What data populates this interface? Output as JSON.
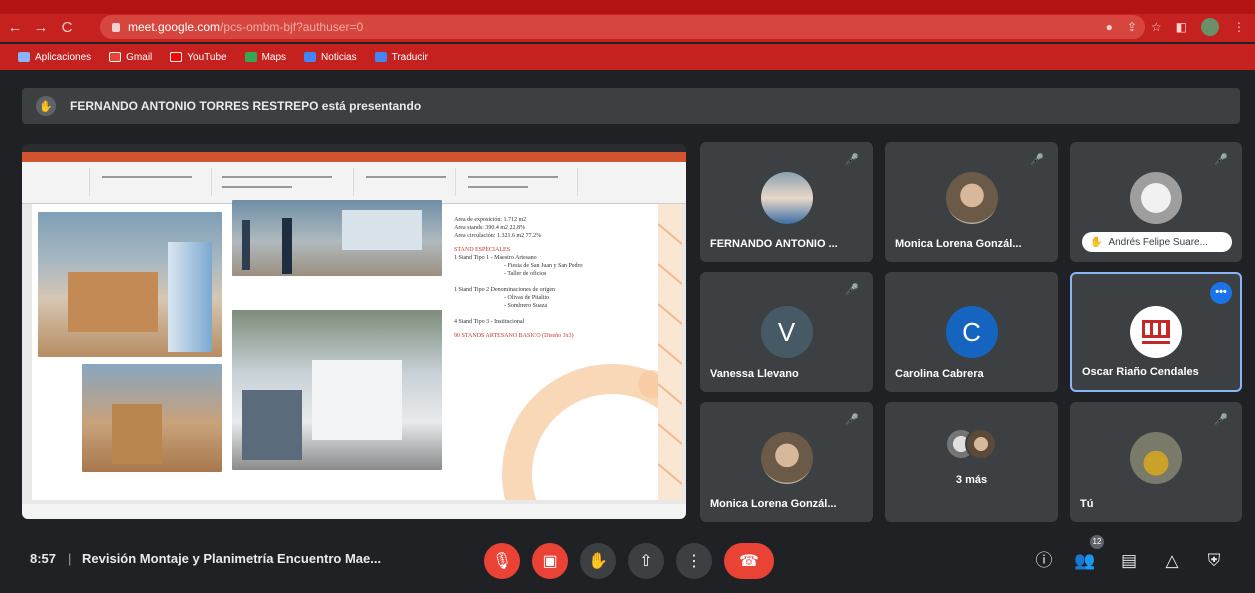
{
  "browser": {
    "url_host": "meet.google.com",
    "url_path": "/pcs-ombm-bjf?authuser=0",
    "bookmarks": [
      {
        "label": "Aplicaciones",
        "color": "#8ab4f8"
      },
      {
        "label": "Gmail",
        "color": "#ea4335"
      },
      {
        "label": "YouTube",
        "color": "#ff0000"
      },
      {
        "label": "Maps",
        "color": "#34a853"
      },
      {
        "label": "Noticias",
        "color": "#4285f4"
      },
      {
        "label": "Traducir",
        "color": "#4285f4"
      }
    ]
  },
  "meet": {
    "presenting_text": "FERNANDO ANTONIO TORRES RESTREPO está presentando",
    "slide": {
      "line1": "Area de exposición:  1.712   m2",
      "line2": "Area stands:          390.4 m2   22.8%",
      "line3": "Area circulación:    1.321.6 m2   77.2%",
      "line4": "STAND ESPECIALES",
      "line5": "1  Stand Tipo 1 - Maestro Artesano",
      "line6": "- Fiesta de San Juan y San Pedro",
      "line7": "- Taller de oficios",
      "line8": "1  Stand Tipo 2 Denominaciones de origen",
      "line9": "- Olivas de Pitalito",
      "line10": "- Sombrero Suaza",
      "line11": "4  Stand Tipo 3 - Institucional",
      "line12": "90 STANDS ARTESANO BASICO (Diseño 3x3)"
    },
    "participants": [
      {
        "name": "FERNANDO ANTONIO ...",
        "type": "photo"
      },
      {
        "name": "Monica Lorena Gonzál...",
        "type": "photo"
      },
      {
        "name": "Andrés Felipe Suare...",
        "type": "photo"
      },
      {
        "name": "Vanessa Llevano",
        "type": "letter",
        "letter": "V",
        "color": "#455a64"
      },
      {
        "name": "Carolina Cabrera",
        "type": "letter",
        "letter": "C",
        "color": "#1565c0"
      },
      {
        "name": "Oscar Riaño Cendales",
        "type": "logo"
      },
      {
        "name": "Monica Lorena Gonzál...",
        "type": "photo"
      },
      {
        "name": "3 más",
        "type": "group"
      },
      {
        "name": "Tú",
        "type": "photo"
      }
    ],
    "bottom": {
      "time": "8:57",
      "separator": "|",
      "meeting_title": "Revisión Montaje y Planimetría Encuentro Mae...",
      "people_count": "12"
    }
  },
  "colors": {
    "chrome_red": "#c5221f",
    "meet_bg": "#202124",
    "tile_bg": "#3c4043",
    "control_red": "#ea4335",
    "active_border": "#8ab4f8"
  }
}
